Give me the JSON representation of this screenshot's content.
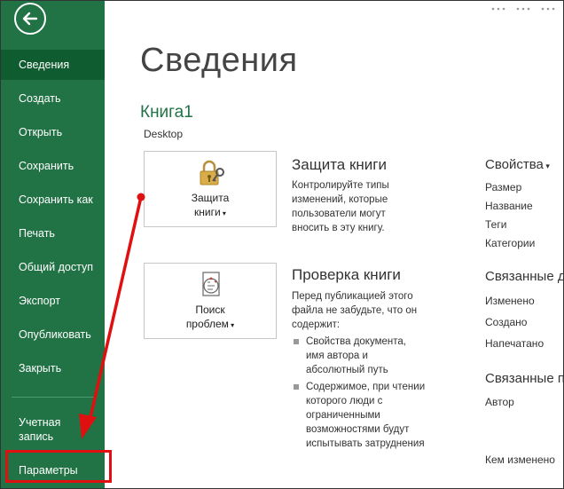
{
  "sidebar": {
    "items": [
      {
        "label": "Сведения",
        "active": true
      },
      {
        "label": "Создать"
      },
      {
        "label": "Открыть"
      },
      {
        "label": "Сохранить"
      },
      {
        "label": "Сохранить как"
      },
      {
        "label": "Печать"
      },
      {
        "label": "Общий доступ"
      },
      {
        "label": "Экспорт"
      },
      {
        "label": "Опубликовать"
      },
      {
        "label": "Закрыть"
      }
    ],
    "account": "Учетная запись",
    "options": "Параметры"
  },
  "main": {
    "title": "Сведения",
    "doc_name": "Книга1",
    "doc_path": "Desktop",
    "protect": {
      "button_line1": "Защита",
      "button_line2": "книги",
      "title": "Защита книги",
      "description": "Контролируйте типы изменений, которые пользователи могут вносить в эту книгу."
    },
    "inspect": {
      "button_line1": "Поиск",
      "button_line2": "проблем",
      "title": "Проверка книги",
      "description": "Перед публикацией этого файла не забудьте, что он содержит:",
      "bullets": [
        "Свойства документа, имя автора и абсолютный путь",
        "Содержимое, при чтении которого люди с ограниченными возможностями будут испытывать затруднения"
      ]
    }
  },
  "properties": {
    "header": "Свойства",
    "items": [
      "Размер",
      "Название",
      "Теги",
      "Категории"
    ],
    "related_dates": "Связанные д",
    "dates": [
      "Изменено",
      "Создано",
      "Напечатано"
    ],
    "related_people": "Связанные п",
    "people": [
      "Автор",
      "Кем изменено"
    ]
  },
  "colors": {
    "sidebar": "#217346",
    "sidebar_active": "#0e5c2f",
    "annotation": "#e01010"
  }
}
